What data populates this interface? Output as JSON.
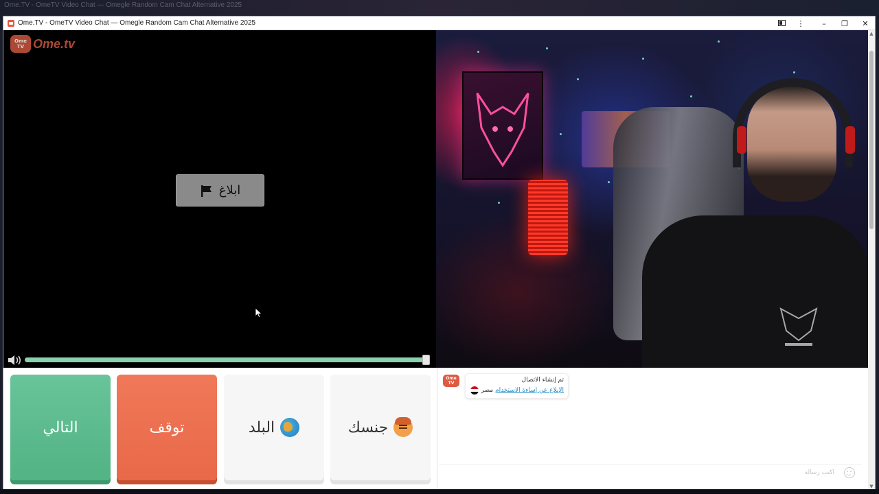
{
  "desktop": {
    "background_window_title": "Ome.TV - OmeTV Video Chat — Omegle Random Cam Chat Alternative 2025"
  },
  "window": {
    "title": "Ome.TV - OmeTV Video Chat — Omegle Random Cam Chat Alternative 2025",
    "controls": [
      "cast-icon",
      "more-icon",
      "minimize-icon",
      "restore-icon",
      "close-icon"
    ]
  },
  "logo": {
    "badge_text": "Ome TV",
    "wordmark": "Ome.tv",
    "color": "#c9563f"
  },
  "remote_video": {
    "report_label": "ابلاغ",
    "volume_level": 1.0
  },
  "controls": {
    "next_label": "التالي",
    "stop_label": "توقف",
    "country_label": "البلد",
    "gender_label": "جنسك",
    "colors": {
      "next": "#5bbb8c",
      "stop": "#ec6f50",
      "neutral": "#f6f6f6"
    }
  },
  "chat": {
    "avatar_text": "Ome TV",
    "messages": [
      {
        "line1": "تم إنشاء الاتصال",
        "country": "مصر",
        "report_link": "الإبلاغ عن إساءة الاستخدام"
      }
    ],
    "input_placeholder": "اكتب رسالة"
  }
}
